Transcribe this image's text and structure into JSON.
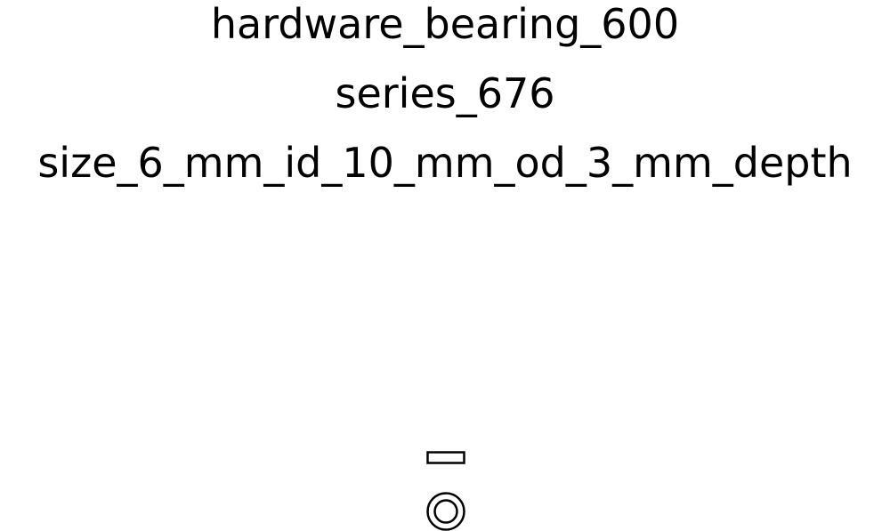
{
  "labels": {
    "category": "hardware_bearing_600",
    "series": "series_676",
    "size": "size_6_mm_id_10_mm_od_3_mm_depth"
  },
  "part": {
    "inner_diameter_mm": 6,
    "outer_diameter_mm": 10,
    "depth_mm": 3
  },
  "colors": {
    "stroke": "#000000",
    "background": "#ffffff"
  }
}
